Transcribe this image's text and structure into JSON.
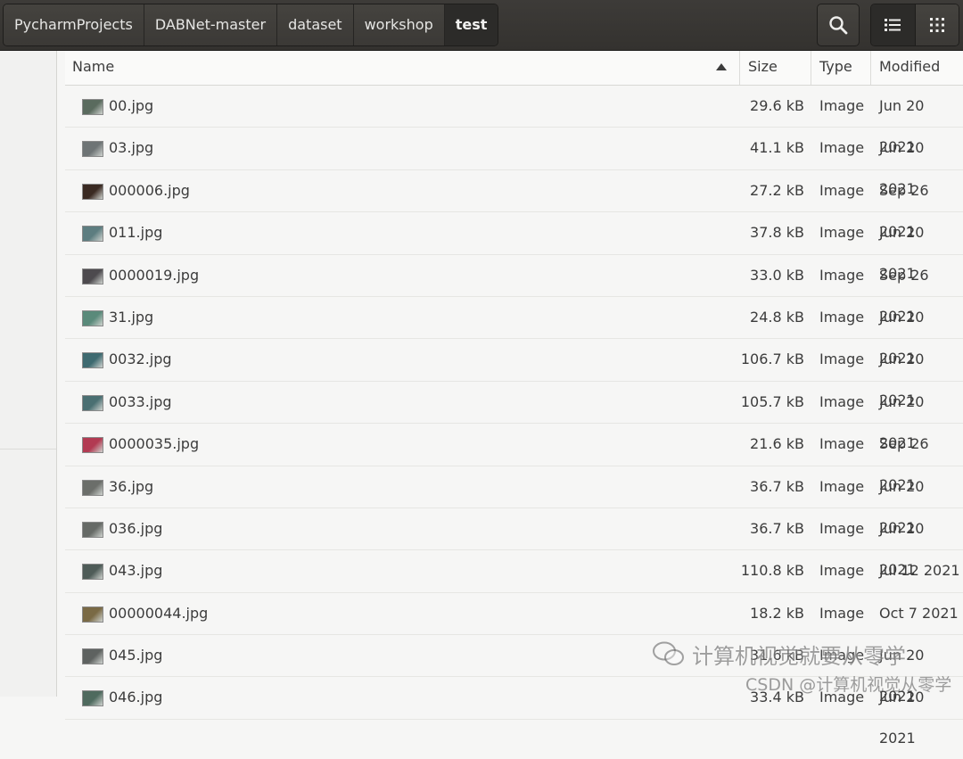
{
  "breadcrumbs": [
    "PycharmProjects",
    "DABNet-master",
    "dataset",
    "workshop",
    "test"
  ],
  "header": {
    "search_icon": "search-icon",
    "list_view_icon": "list-view-icon",
    "grid_view_icon": "grid-view-icon"
  },
  "columns": {
    "name": "Name",
    "size": "Size",
    "type": "Type",
    "modified": "Modified"
  },
  "files": [
    {
      "name": "00.jpg",
      "size": "29.6 kB",
      "type": "Image",
      "modified": "Jun 20 2021",
      "thumb": "#5a6b5e"
    },
    {
      "name": "03.jpg",
      "size": "41.1 kB",
      "type": "Image",
      "modified": "Jun 20 2021",
      "thumb": "#6e7475"
    },
    {
      "name": "000006.jpg",
      "size": "27.2 kB",
      "type": "Image",
      "modified": "Sep 26 2021",
      "thumb": "#3a2a22"
    },
    {
      "name": "011.jpg",
      "size": "37.8 kB",
      "type": "Image",
      "modified": "Jun 20 2021",
      "thumb": "#5d7d80"
    },
    {
      "name": "0000019.jpg",
      "size": "33.0 kB",
      "type": "Image",
      "modified": "Sep 26 2021",
      "thumb": "#4d4a4e"
    },
    {
      "name": "31.jpg",
      "size": "24.8 kB",
      "type": "Image",
      "modified": "Jun 20 2021",
      "thumb": "#5a8a7a"
    },
    {
      "name": "0032.jpg",
      "size": "106.7 kB",
      "type": "Image",
      "modified": "Jun 20 2021",
      "thumb": "#3e6a70"
    },
    {
      "name": "0033.jpg",
      "size": "105.7 kB",
      "type": "Image",
      "modified": "Jun 20 2021",
      "thumb": "#4a6f72"
    },
    {
      "name": "0000035.jpg",
      "size": "21.6 kB",
      "type": "Image",
      "modified": "Sep 26 2021",
      "thumb": "#b23a52"
    },
    {
      "name": "36.jpg",
      "size": "36.7 kB",
      "type": "Image",
      "modified": "Jun 20 2021",
      "thumb": "#6b6e6a"
    },
    {
      "name": "036.jpg",
      "size": "36.7 kB",
      "type": "Image",
      "modified": "Jun 20 2021",
      "thumb": "#666a66"
    },
    {
      "name": "043.jpg",
      "size": "110.8 kB",
      "type": "Image",
      "modified": "Jul 12 2021",
      "thumb": "#4f5c58"
    },
    {
      "name": "00000044.jpg",
      "size": "18.2 kB",
      "type": "Image",
      "modified": "Oct 7 2021",
      "thumb": "#7a6a45"
    },
    {
      "name": "045.jpg",
      "size": "31.6 kB",
      "type": "Image",
      "modified": "Jun 20 2021",
      "thumb": "#5e6260"
    },
    {
      "name": "046.jpg",
      "size": "33.4 kB",
      "type": "Image",
      "modified": "Jun 20 2021",
      "thumb": "#4f6a5e"
    }
  ],
  "watermark": {
    "line1": "计算机视觉就要从零学",
    "line2": "CSDN @计算机视觉从零学"
  }
}
